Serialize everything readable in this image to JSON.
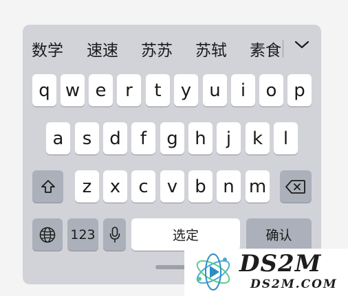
{
  "candidates": [
    "数学",
    "速速",
    "苏苏",
    "苏轼",
    "素食"
  ],
  "rows": {
    "row1": [
      "q",
      "w",
      "e",
      "r",
      "t",
      "y",
      "u",
      "i",
      "o",
      "p"
    ],
    "row2": [
      "a",
      "s",
      "d",
      "f",
      "g",
      "h",
      "j",
      "k",
      "l"
    ],
    "row3": [
      "z",
      "x",
      "c",
      "v",
      "b",
      "n",
      "m"
    ]
  },
  "bottom": {
    "numbers_label": "123",
    "space_label": "选定",
    "confirm_label": "确认"
  },
  "icons": {
    "collapse": "chevron-down-icon",
    "shift": "shift-icon",
    "delete": "delete-icon",
    "globe": "globe-icon",
    "microphone": "microphone-icon"
  },
  "watermark": {
    "title": "DS2M",
    "subtitle": "DS2M.COM"
  },
  "colors": {
    "keyboard_bg": "#d1d3d9",
    "key_bg": "#ffffff",
    "function_key_bg": "#abb0ba"
  }
}
